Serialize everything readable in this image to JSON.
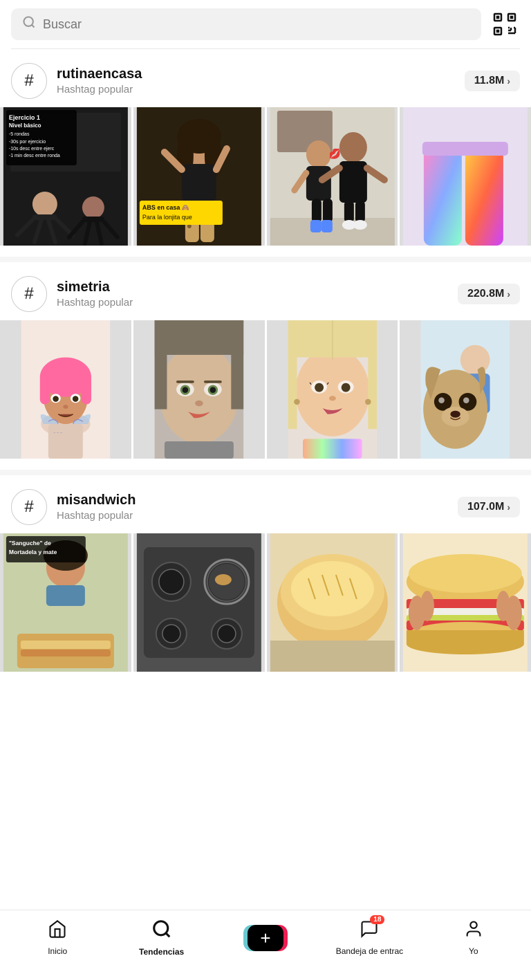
{
  "search": {
    "placeholder": "Buscar",
    "value": ""
  },
  "sections": [
    {
      "id": "rutinaencasa",
      "name": "rutinaencasa",
      "subtitle": "Hashtag popular",
      "count": "11.8M",
      "thumbs": [
        {
          "type": "exercise",
          "badge_top": "Ejercicio 1\nNivel básico\n-5 rondas\n-30s por ejercicio\n-10s desc entre ejerc\n-1 min desc entre ronda",
          "has_top_badge": true
        },
        {
          "type": "pose",
          "badge_bottom": "ABS en casa 🙈\nPara la lonjita que",
          "has_yellow_badge": true
        },
        {
          "type": "couple",
          "has_badge": false
        },
        {
          "type": "legs",
          "has_badge": false
        }
      ]
    },
    {
      "id": "simetria",
      "name": "simetria",
      "subtitle": "Hashtag popular",
      "count": "220.8M",
      "thumbs": [
        {
          "type": "pink_hair",
          "has_badge": false
        },
        {
          "type": "close_face1",
          "has_badge": false
        },
        {
          "type": "close_face2",
          "has_badge": false
        },
        {
          "type": "dog",
          "has_badge": false
        }
      ]
    },
    {
      "id": "misandwich",
      "name": "misandwich",
      "subtitle": "Hashtag popular",
      "count": "107.0M",
      "thumbs": [
        {
          "type": "sandwich1",
          "badge_top": "\"Sanguche\" de\nMortadela y mate",
          "has_top_badge": true
        },
        {
          "type": "sandwich2",
          "has_badge": false
        },
        {
          "type": "sandwich3",
          "has_badge": false
        },
        {
          "type": "sandwich4",
          "has_badge": false
        }
      ]
    }
  ],
  "nav": {
    "items": [
      {
        "id": "inicio",
        "label": "Inicio",
        "icon": "home"
      },
      {
        "id": "tendencias",
        "label": "Tendencias",
        "icon": "search",
        "active": true
      },
      {
        "id": "plus",
        "label": "",
        "icon": "plus"
      },
      {
        "id": "inbox",
        "label": "Bandeja de entrac",
        "icon": "inbox",
        "badge": "18"
      },
      {
        "id": "yo",
        "label": "Yo",
        "icon": "person"
      }
    ]
  }
}
